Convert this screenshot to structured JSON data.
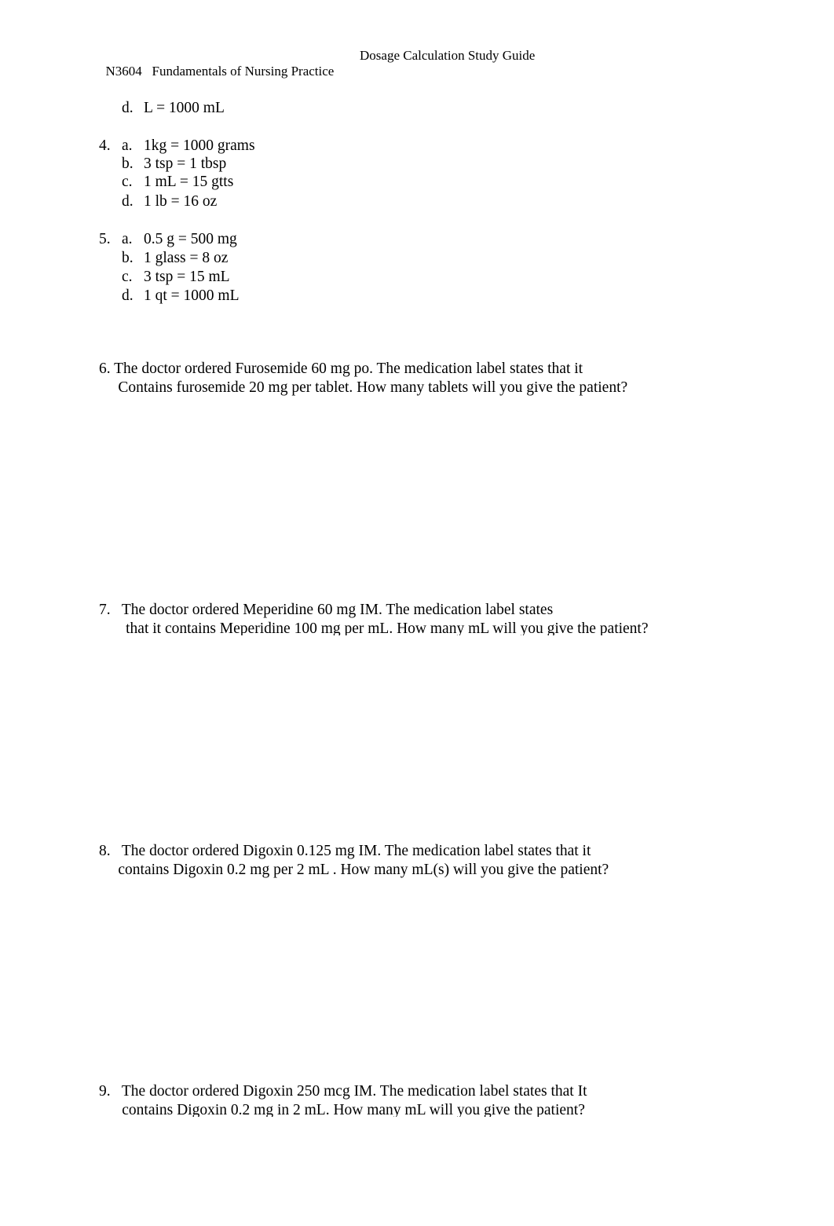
{
  "header": {
    "course": "N3604   Fundamentals of Nursing Practice",
    "title": "Dosage Calculation Study Guide"
  },
  "prev_item": {
    "letter": "d.",
    "text": " L = 1000  mL"
  },
  "questions_conversions": [
    {
      "number": "4.",
      "items": [
        {
          "letter": "a.",
          "text": "1kg = 1000   grams"
        },
        {
          "letter": "b.",
          "text": "3 tsp =    1 tbsp"
        },
        {
          "letter": "c.",
          "text": "1 mL = 15  gtts"
        },
        {
          "letter": "d.",
          "text": "1 lb =    16 oz"
        }
      ]
    },
    {
      "number": "5.",
      "items": [
        {
          "letter": "a.",
          "text": "0.5 g = 500   mg"
        },
        {
          "letter": "b.",
          "text": "1 glass = 8   oz"
        },
        {
          "letter": "c.",
          "text": "3 tsp = 15   mL"
        },
        {
          "letter": "d.",
          "text": "1 qt = 1000   mL"
        }
      ]
    }
  ],
  "word_problems": [
    {
      "line1": "6. The doctor ordered Furosemide 60 mg po. The medication label states that it",
      "line2": "     Contains furosemide 20 mg per tablet. How many tablets will you give the patient?"
    },
    {
      "line1": "7.   The doctor ordered Meperidine 60 mg IM. The medication label states",
      "line2": "       that it contains Meperidine 100 mg per mL. How many mL will you give the patient?"
    },
    {
      "line1": "8.   The doctor ordered Digoxin 0.125 mg IM. The medication label states that it",
      "line2": "     contains Digoxin 0.2 mg per 2 mL . How many mL(s) will you give the patient?"
    },
    {
      "line1": "9.   The doctor ordered Digoxin 250 mcg IM. The medication label states that It",
      "line2": "      contains Digoxin 0.2 mg in 2 mL. How many mL will you give the patient?"
    }
  ]
}
